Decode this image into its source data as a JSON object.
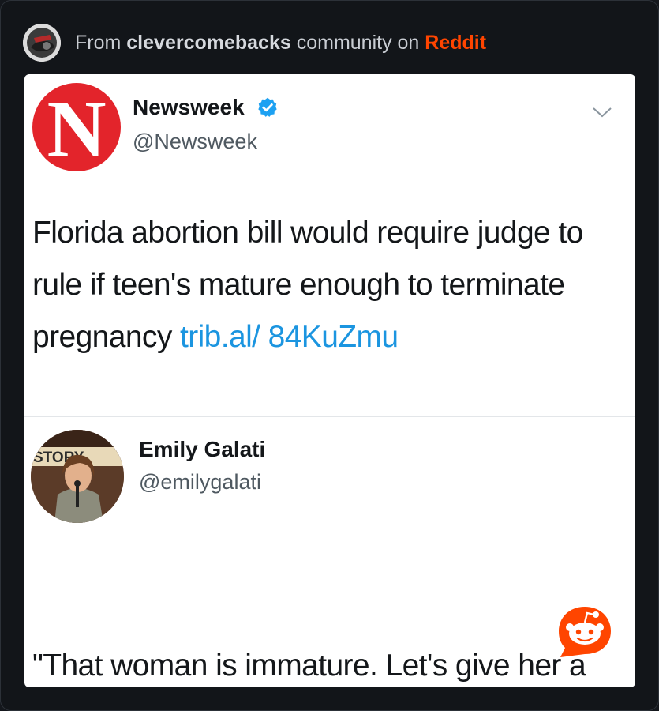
{
  "header": {
    "prefix": "From",
    "community": "clevercomebacks",
    "middle": "community on",
    "platform": "Reddit"
  },
  "tweets": [
    {
      "avatar_letter": "N",
      "name": "Newsweek",
      "handle": "@Newsweek",
      "verified": true,
      "text": "Florida abortion bill would require judge to rule if teen's mature enough to terminate pregnancy ",
      "link": "trib.al/ 84KuZmu"
    },
    {
      "name": "Emily Galati",
      "handle": "@emilygalati",
      "avatar_sign": "STORY",
      "text": "\"That woman is immature. Let's give her a kid.\" -Florida"
    }
  ],
  "colors": {
    "reddit": "#ff4500",
    "link": "#1b95e0",
    "newsweek_red": "#e3242b",
    "verified_blue": "#1da1f2"
  }
}
